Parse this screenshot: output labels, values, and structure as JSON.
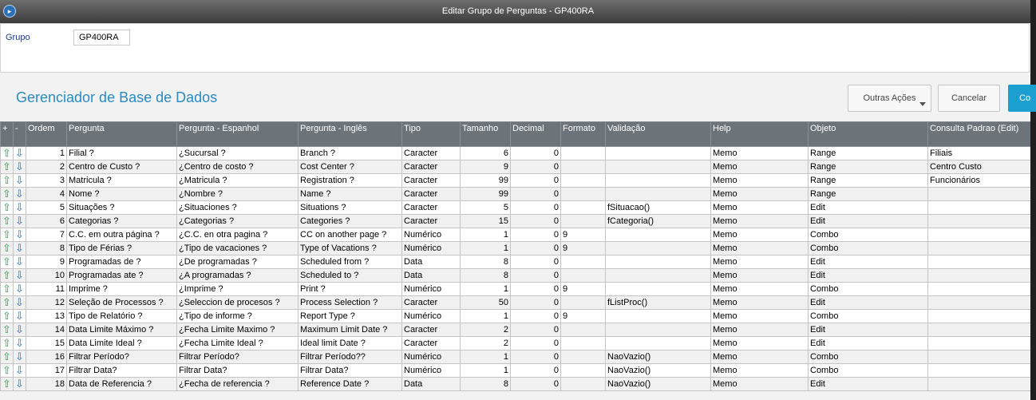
{
  "window": {
    "title": "Editar Grupo de Perguntas - GP400RA"
  },
  "form": {
    "grupo_label": "Grupo",
    "grupo_value": "GP400RA"
  },
  "page": {
    "title": "Gerenciador de Base de Dados"
  },
  "buttons": {
    "outras_acoes": "Outras Ações",
    "cancelar": "Cancelar",
    "confirmar": "Co"
  },
  "grid": {
    "headers": [
      "+",
      "-",
      "Ordem",
      "Pergunta",
      "Pergunta - Espanhol",
      "Pergunta - Inglês",
      "Tipo",
      "Tamanho",
      "Decimal",
      "Formato",
      "Validação",
      "Help",
      "Objeto",
      "Consulta Padrao (Edit)"
    ],
    "rows": [
      {
        "ordem": "1",
        "pergunta": "Filial ?",
        "espanhol": "¿Sucursal ?",
        "ingles": "Branch ?",
        "tipo": "Caracter",
        "tamanho": "6",
        "decimal": "0",
        "formato": "",
        "validacao": "",
        "help": "Memo",
        "objeto": "Range",
        "consulta": "Filiais"
      },
      {
        "ordem": "2",
        "pergunta": "Centro de Custo ?",
        "espanhol": "¿Centro de costo ?",
        "ingles": "Cost Center ?",
        "tipo": "Caracter",
        "tamanho": "9",
        "decimal": "0",
        "formato": "",
        "validacao": "",
        "help": "Memo",
        "objeto": "Range",
        "consulta": "Centro Custo"
      },
      {
        "ordem": "3",
        "pergunta": "Matricula ?",
        "espanhol": "¿Matricula ?",
        "ingles": "Registration ?",
        "tipo": "Caracter",
        "tamanho": "99",
        "decimal": "0",
        "formato": "",
        "validacao": "",
        "help": "Memo",
        "objeto": "Range",
        "consulta": "Funcionários"
      },
      {
        "ordem": "4",
        "pergunta": "Nome ?",
        "espanhol": "¿Nombre ?",
        "ingles": "Name ?",
        "tipo": "Caracter",
        "tamanho": "99",
        "decimal": "0",
        "formato": "",
        "validacao": "",
        "help": "Memo",
        "objeto": "Range",
        "consulta": ""
      },
      {
        "ordem": "5",
        "pergunta": "Situações ?",
        "espanhol": "¿Situaciones ?",
        "ingles": "Situations ?",
        "tipo": "Caracter",
        "tamanho": "5",
        "decimal": "0",
        "formato": "",
        "validacao": "fSituacao()",
        "help": "Memo",
        "objeto": "Edit",
        "consulta": ""
      },
      {
        "ordem": "6",
        "pergunta": "Categorias ?",
        "espanhol": "¿Categorias ?",
        "ingles": "Categories ?",
        "tipo": "Caracter",
        "tamanho": "15",
        "decimal": "0",
        "formato": "",
        "validacao": "fCategoria()",
        "help": "Memo",
        "objeto": "Edit",
        "consulta": ""
      },
      {
        "ordem": "7",
        "pergunta": "C.C. em outra página ?",
        "espanhol": "¿C.C. en otra pagina ?",
        "ingles": "CC on another page ?",
        "tipo": "Numérico",
        "tamanho": "1",
        "decimal": "0",
        "formato": "9",
        "validacao": "",
        "help": "Memo",
        "objeto": "Combo",
        "consulta": ""
      },
      {
        "ordem": "8",
        "pergunta": "Tipo de Férias ?",
        "espanhol": "¿Tipo de vacaciones ?",
        "ingles": "Type of Vacations ?",
        "tipo": "Numérico",
        "tamanho": "1",
        "decimal": "0",
        "formato": "9",
        "validacao": "",
        "help": "Memo",
        "objeto": "Combo",
        "consulta": ""
      },
      {
        "ordem": "9",
        "pergunta": "Programadas de ?",
        "espanhol": "¿De programadas ?",
        "ingles": "Scheduled from ?",
        "tipo": "Data",
        "tamanho": "8",
        "decimal": "0",
        "formato": "",
        "validacao": "",
        "help": "Memo",
        "objeto": "Edit",
        "consulta": ""
      },
      {
        "ordem": "10",
        "pergunta": "Programadas ate ?",
        "espanhol": "¿A programadas ?",
        "ingles": "Scheduled to ?",
        "tipo": "Data",
        "tamanho": "8",
        "decimal": "0",
        "formato": "",
        "validacao": "",
        "help": "Memo",
        "objeto": "Edit",
        "consulta": ""
      },
      {
        "ordem": "11",
        "pergunta": "Imprime ?",
        "espanhol": "¿Imprime ?",
        "ingles": "Print ?",
        "tipo": "Numérico",
        "tamanho": "1",
        "decimal": "0",
        "formato": "9",
        "validacao": "",
        "help": "Memo",
        "objeto": "Combo",
        "consulta": ""
      },
      {
        "ordem": "12",
        "pergunta": "Seleção de Processos ?",
        "espanhol": "¿Seleccion de procesos ?",
        "ingles": "Process Selection ?",
        "tipo": "Caracter",
        "tamanho": "50",
        "decimal": "0",
        "formato": "",
        "validacao": "fListProc()",
        "help": "Memo",
        "objeto": "Edit",
        "consulta": ""
      },
      {
        "ordem": "13",
        "pergunta": "Tipo de Relatório ?",
        "espanhol": "¿Tipo de informe ?",
        "ingles": "Report Type ?",
        "tipo": "Numérico",
        "tamanho": "1",
        "decimal": "0",
        "formato": "9",
        "validacao": "",
        "help": "Memo",
        "objeto": "Combo",
        "consulta": ""
      },
      {
        "ordem": "14",
        "pergunta": "Data Limite Máximo ?",
        "espanhol": "¿Fecha Limite Maximo ?",
        "ingles": "Maximum Limit Date ?",
        "tipo": "Caracter",
        "tamanho": "2",
        "decimal": "0",
        "formato": "",
        "validacao": "",
        "help": "Memo",
        "objeto": "Edit",
        "consulta": ""
      },
      {
        "ordem": "15",
        "pergunta": "Data Limite Ideal ?",
        "espanhol": "¿Fecha Limite Ideal ?",
        "ingles": "Ideal limit Date ?",
        "tipo": "Caracter",
        "tamanho": "2",
        "decimal": "0",
        "formato": "",
        "validacao": "",
        "help": "Memo",
        "objeto": "Edit",
        "consulta": ""
      },
      {
        "ordem": "16",
        "pergunta": "Filtrar Período?",
        "espanhol": "Filtrar Período?",
        "ingles": "Filtrar Período??",
        "tipo": "Numérico",
        "tamanho": "1",
        "decimal": "0",
        "formato": "",
        "validacao": "NaoVazio()",
        "help": "Memo",
        "objeto": "Combo",
        "consulta": ""
      },
      {
        "ordem": "17",
        "pergunta": "Filtrar Data?",
        "espanhol": "Filtrar Data?",
        "ingles": "Filtrar Data?",
        "tipo": "Numérico",
        "tamanho": "1",
        "decimal": "0",
        "formato": "",
        "validacao": "NaoVazio()",
        "help": "Memo",
        "objeto": "Combo",
        "consulta": ""
      },
      {
        "ordem": "18",
        "pergunta": "Data de Referencia ?",
        "espanhol": "¿Fecha de referencia ?",
        "ingles": "Reference Date ?",
        "tipo": "Data",
        "tamanho": "8",
        "decimal": "0",
        "formato": "",
        "validacao": "NaoVazio()",
        "help": "Memo",
        "objeto": "Edit",
        "consulta": ""
      }
    ]
  },
  "icons": {
    "app": "totvs-logo-icon",
    "up": "arrow-up-icon",
    "down": "arrow-down-icon",
    "dropdown": "caret-down-icon"
  },
  "colors": {
    "accent": "#1a9fd0",
    "title": "#2a8ac4",
    "header_bg": "#6c747a",
    "titlebar": "#4a4a4a"
  }
}
